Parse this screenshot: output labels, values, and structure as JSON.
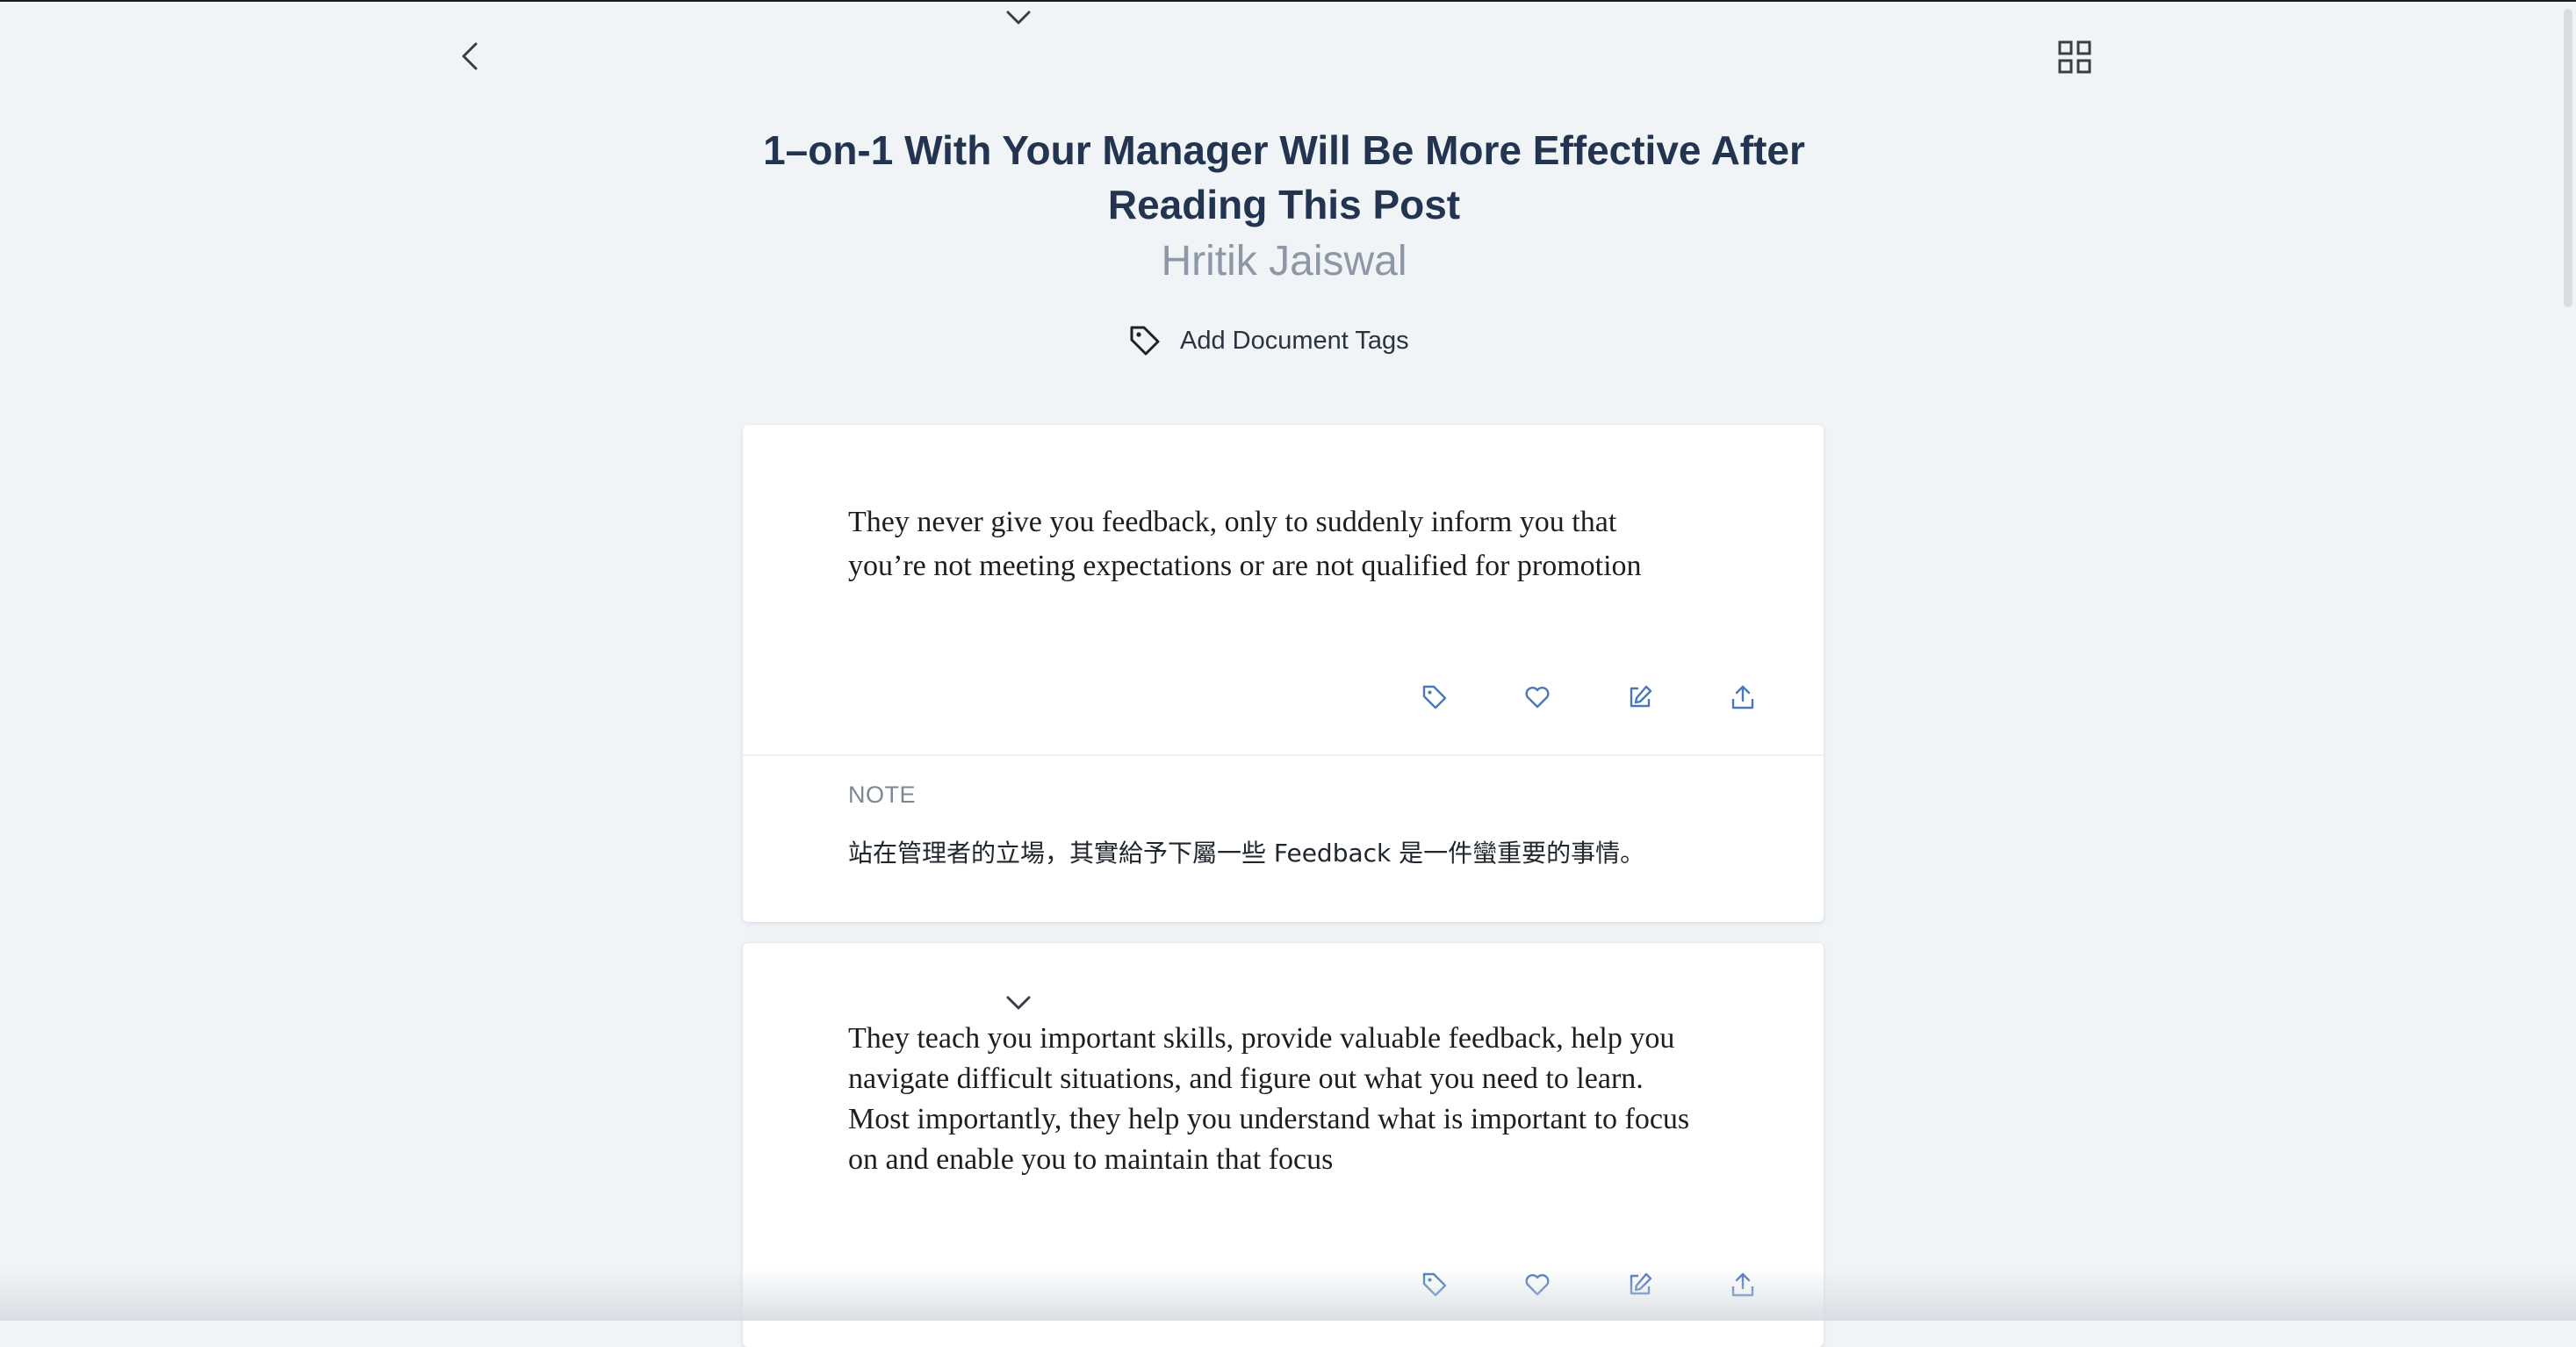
{
  "document": {
    "title_line1": "1–on-1 With Your Manager Will Be More Effective After",
    "title_line2": "Reading This Post",
    "author": "Hritik Jaiswal",
    "add_tags_label": "Add Document Tags"
  },
  "highlights": [
    {
      "text": "They never give you feedback, only to suddenly inform you that you’re not meeting expectations or are not qualified for promotion",
      "note_label": "NOTE",
      "note": "站在管理者的立場，其實給予下屬一些 Feedback 是一件蠻重要的事情。"
    },
    {
      "text": "They teach you important skills, provide valuable feedback, help you navigate difficult situations, and figure out what you need to learn. Most importantly, they help you understand what is important to focus on and enable you to maintain that focus"
    }
  ],
  "icons": {
    "back": "chevron-left-icon",
    "view": "grid-icon",
    "tag": "tag-icon",
    "like": "heart-icon",
    "edit": "edit-icon",
    "share": "share-icon",
    "expand": "chevron-down-icon"
  },
  "colors": {
    "background": "#f0f4f7",
    "title": "#22344f",
    "author": "#8d97a6",
    "action_icons": "#4a78b8"
  }
}
